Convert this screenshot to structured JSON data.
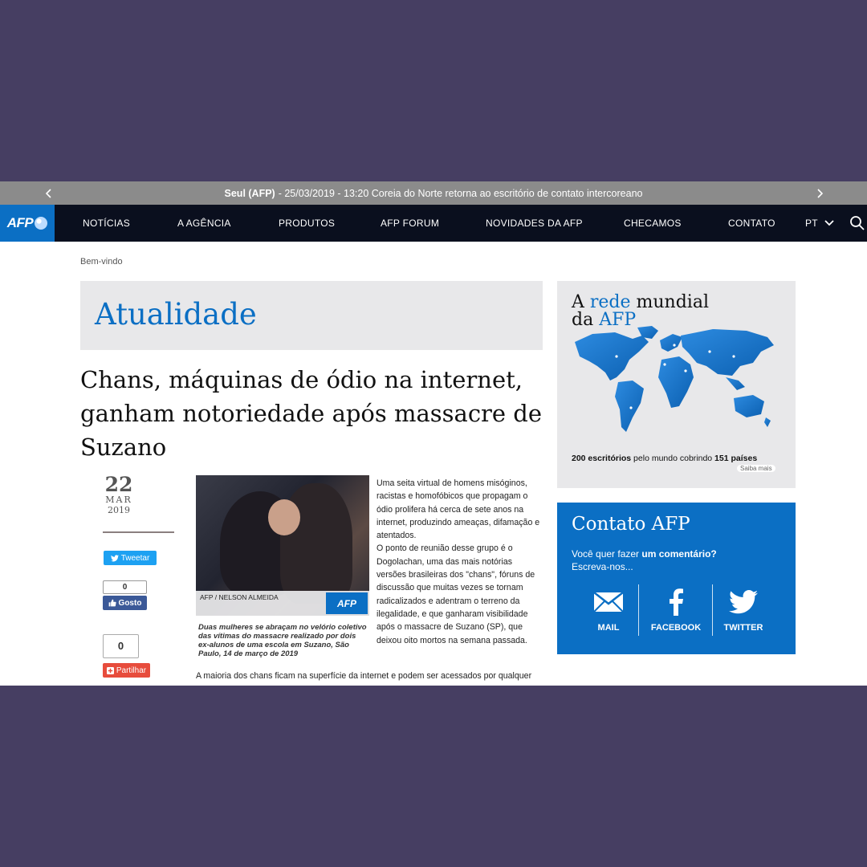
{
  "ticker": {
    "place": "Seul (AFP)",
    "text": " - 25/03/2019 - 13:20 Coreia do Norte retorna ao escritório de contato intercoreano"
  },
  "nav": {
    "logo": "AFP",
    "items": [
      "NOTÍCIAS",
      "A AGÊNCIA",
      "PRODUTOS",
      "AFP FORUM",
      "NOVIDADES DA AFP",
      "CHECAMOS",
      "CONTATO"
    ],
    "language": "PT"
  },
  "breadcrumb": "Bem-vindo",
  "section_title": "Atualidade",
  "article": {
    "headline": "Chans, máquinas de ódio na internet, ganham notoriedade após massacre de Suzano",
    "date": {
      "day": "22",
      "month": "MAR",
      "year": "2019"
    },
    "photo_credit": "AFP / NELSON ALMEIDA",
    "photo_logo": "AFP",
    "caption": "Duas mulheres se abraçam no velório coletivo das vítimas do massacre realizado por dois ex-alunos de uma escola em Suzano, São Paulo, 14 de março de 2019",
    "paragraph1": "Uma seita virtual de homens misóginos, racistas e homofóbicos que propagam o ódio prolifera há cerca de sete anos na internet, produzindo ameaças, difamação e atentados.",
    "paragraph2": "O ponto de reunião desse grupo é o Dogolachan, uma das mais notórias versões brasileiras dos \"chans\", fóruns de discussão que muitas vezes se tornam radicalizados e adentram o terreno da ilegalidade, e que ganharam visibilidade após o massacre de Suzano (SP), que deixou oito mortos na semana passada.",
    "paragraph3": "A maioria dos chans ficam na superfície da internet e podem ser acessados por qualquer"
  },
  "social": {
    "tweet_label": "Tweetar",
    "like_count": "0",
    "like_label": "Gosto",
    "share_count": "0",
    "share_label": "Partilhar"
  },
  "map_box": {
    "title_prefix": "A ",
    "title_highlight1": "rede",
    "title_middle": " mundial",
    "title_line2_prefix": "da ",
    "title_highlight2": "AFP",
    "offices": "200 escritórios",
    "stats_middle": " pelo mundo cobrindo ",
    "countries": "151 países",
    "more": "Saiba mais",
    "accent": "#0b6fc4"
  },
  "contact": {
    "title": "Contato AFP",
    "question_prefix": "Você quer fazer ",
    "question_bold": "um comentário?",
    "question_line2": "Escreva-nos...",
    "items": [
      "MAIL",
      "FACEBOOK",
      "TWITTER"
    ],
    "icons": [
      "mail-icon",
      "facebook-icon",
      "twitter-icon"
    ]
  },
  "colors": {
    "accent": "#0b6fc4",
    "nav_bg": "#0a0f1e",
    "ticker_bg": "#8b8b8b",
    "frame_bg": "#463e62"
  }
}
